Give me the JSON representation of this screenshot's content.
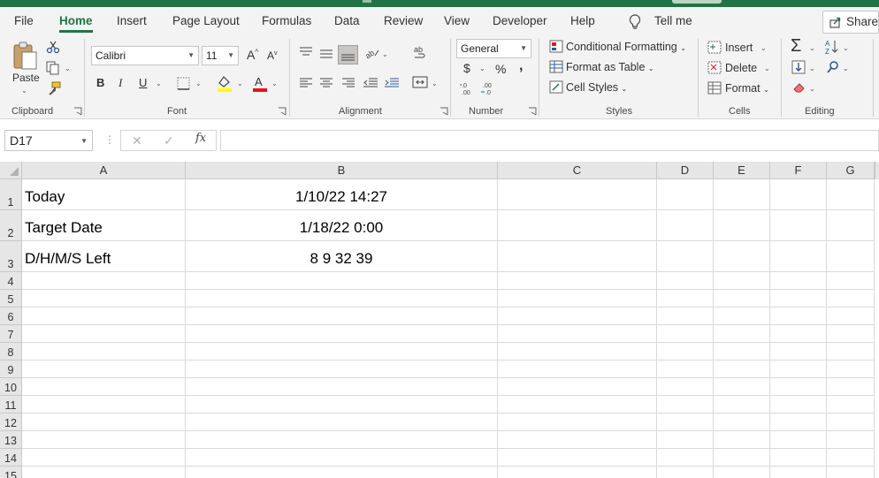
{
  "ribbon_tabs": [
    "File",
    "Home",
    "Insert",
    "Page Layout",
    "Formulas",
    "Data",
    "Review",
    "View",
    "Developer",
    "Help"
  ],
  "tell_me": "Tell me",
  "share": "Share",
  "clipboard": {
    "paste": "Paste",
    "label": "Clipboard"
  },
  "font": {
    "name": "Calibri",
    "size": "11",
    "bold": "B",
    "italic": "I",
    "underline": "U",
    "label": "Font",
    "fill_color": "#ffff00",
    "font_color": "#ff0000"
  },
  "alignment": {
    "label": "Alignment"
  },
  "number": {
    "format": "General",
    "currency": "$",
    "percent": "%",
    "comma": ",",
    "label": "Number"
  },
  "styles": {
    "conditional": "Conditional Formatting",
    "table": "Format as Table",
    "cell_styles": "Cell Styles",
    "label": "Styles"
  },
  "cells": {
    "insert": "Insert",
    "delete": "Delete",
    "format": "Format",
    "label": "Cells"
  },
  "editing": {
    "label": "Editing"
  },
  "formula_bar": {
    "name_box": "D17",
    "fx": "fx",
    "value": ""
  },
  "columns": [
    "A",
    "B",
    "C",
    "D",
    "E",
    "F",
    "G"
  ],
  "rows": [
    "1",
    "2",
    "3",
    "4",
    "5",
    "6",
    "7",
    "8",
    "9",
    "10",
    "11",
    "12",
    "13",
    "14",
    "15"
  ],
  "cells_data": {
    "A1": "Today",
    "B1": "1/10/22 14:27",
    "A2": "Target Date",
    "B2": "1/18/22 0:00",
    "A3": "D/H/M/S Left",
    "B3": "8 9 32 39"
  },
  "accent_color": "#217346"
}
